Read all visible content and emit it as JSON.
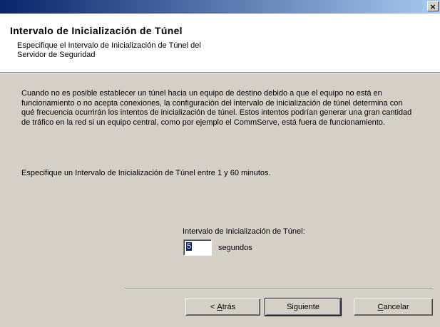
{
  "window": {
    "close_glyph": "×"
  },
  "header": {
    "title": "Intervalo de Inicialización de Túnel",
    "subtitle_line1": "Especifique el Intervalo de Inicialización de Túnel del",
    "subtitle_line2": "Servidor de Seguridad"
  },
  "body": {
    "description": "Cuando no es posible establecer un túnel hacia un equipo de destino debido a que el equipo no está en funcionamiento o no acepta conexiones, la configuración del intervalo de inicialización de túnel determina con qué frecuencia ocurrirán los intentos de inicialización de túnel.  Estos intentos podrían generar una gran cantidad de tráfico en la red si un equipo central, como por ejemplo el CommServe, está fuera de funcionamiento.",
    "instruction": "Especifique un Intervalo de Inicialización de Túnel entre 1 y 60 minutos."
  },
  "field": {
    "label": "Intervalo de Inicialización de Túnel:",
    "value": "5",
    "unit": "segundos"
  },
  "buttons": {
    "back_prefix": "< ",
    "back_accel": "A",
    "back_rest": "trás",
    "next": "Siguiente",
    "cancel_accel": "C",
    "cancel_rest": "ancelar"
  }
}
